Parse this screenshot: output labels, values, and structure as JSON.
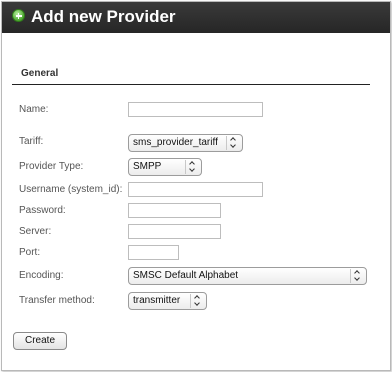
{
  "window": {
    "title": "Add new Provider",
    "title_icon": "plus-circle-icon"
  },
  "section": {
    "label": "General"
  },
  "fields": {
    "name": {
      "label": "Name:",
      "value": ""
    },
    "tariff": {
      "label": "Tariff:",
      "value": "sms_provider_tariff"
    },
    "provider_type": {
      "label": "Provider Type:",
      "value": "SMPP"
    },
    "username": {
      "label": "Username (system_id):",
      "value": ""
    },
    "password": {
      "label": "Password:",
      "value": ""
    },
    "server": {
      "label": "Server:",
      "value": ""
    },
    "port": {
      "label": "Port:",
      "value": ""
    },
    "encoding": {
      "label": "Encoding:",
      "value": "SMSC Default Alphabet"
    },
    "transfer_method": {
      "label": "Transfer method:",
      "value": "transmitter"
    }
  },
  "actions": {
    "create_label": "Create"
  }
}
